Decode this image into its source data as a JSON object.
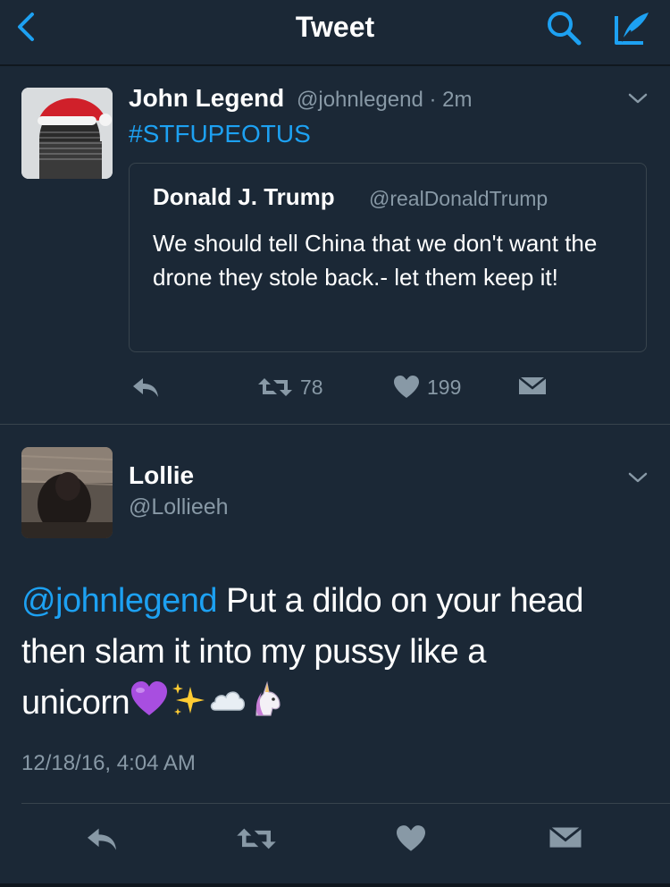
{
  "nav": {
    "title": "Tweet",
    "back_icon": "chevron-left-icon",
    "search_icon": "search-icon",
    "compose_icon": "compose-icon",
    "accent_color": "#1da1f2"
  },
  "tweet1": {
    "name": "John Legend",
    "handle": "@johnlegend",
    "separator": "·",
    "time": "2m",
    "text": "#STFUPEOTUS",
    "quote": {
      "name": "Donald J. Trump",
      "handle": "@realDonaldTrump",
      "text": "We should tell China that we don't want the drone they stole back.- let them keep it!"
    },
    "actions": {
      "retweets": "78",
      "likes": "199"
    }
  },
  "tweet2": {
    "name": "Lollie",
    "handle": "@Lollieeh",
    "mention": "@johnlegend",
    "text_line1_rest": " Put a dildo on your head",
    "text_line2": "then slam it into my pussy like a",
    "text_line3": "unicorn",
    "emoji": [
      "purple-heart",
      "sparkles",
      "cloud",
      "unicorn"
    ],
    "timestamp": "12/18/16, 4:04 AM"
  },
  "colors": {
    "background": "#1b2836",
    "muted": "#8899a6",
    "link": "#1da1f2",
    "border": "#38444d"
  }
}
